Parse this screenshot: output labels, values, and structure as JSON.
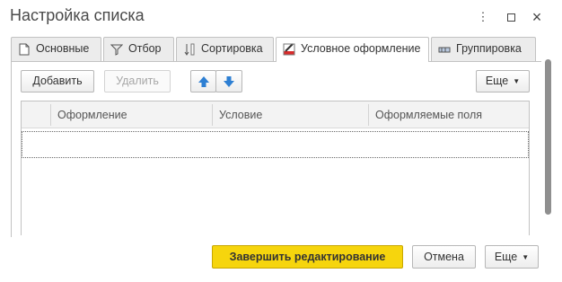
{
  "window": {
    "title": "Настройка списка"
  },
  "tabs": [
    {
      "label": "Основные",
      "icon": "document-icon",
      "active": false
    },
    {
      "label": "Отбор",
      "icon": "filter-icon",
      "active": false
    },
    {
      "label": "Сортировка",
      "icon": "sort-icon",
      "active": false
    },
    {
      "label": "Условное оформление",
      "icon": "brush-icon",
      "active": true
    },
    {
      "label": "Группировка",
      "icon": "grouping-icon",
      "active": false
    }
  ],
  "toolbar": {
    "add_label": "Добавить",
    "delete_label": "Удалить",
    "more_label": "Еще"
  },
  "grid": {
    "columns": [
      "Оформление",
      "Условие",
      "Оформляемые поля"
    ],
    "rows": []
  },
  "footer": {
    "finish_label": "Завершить редактирование",
    "cancel_label": "Отмена",
    "more_label": "Еще"
  },
  "colors": {
    "accent_yellow": "#f6d50d",
    "arrow_blue": "#2d7fd3",
    "border": "#c2c2c2"
  }
}
